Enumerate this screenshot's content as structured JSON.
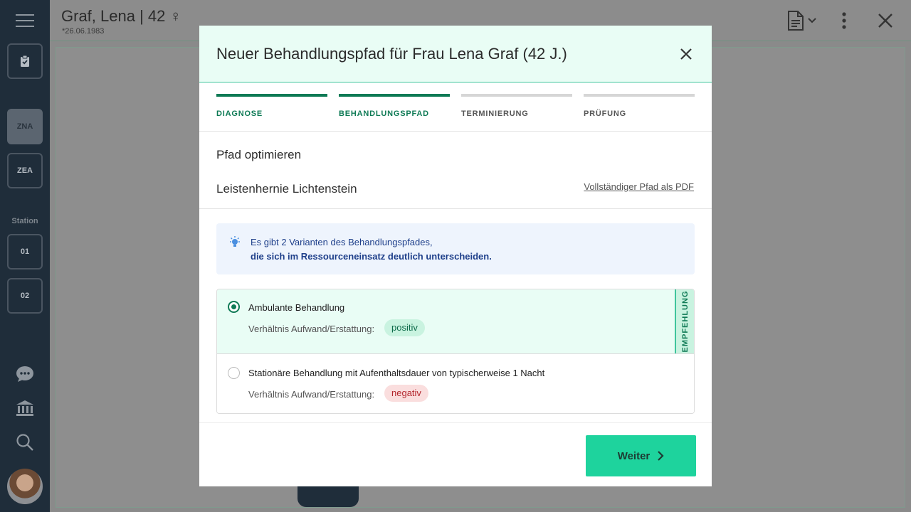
{
  "topbar": {
    "patient_name": "Graf, Lena | 42 ♀",
    "patient_dob": "*26.06.1983"
  },
  "sidebar": {
    "items": [
      {
        "label": "ZNA",
        "active": true
      },
      {
        "label": "ZEA",
        "active": false
      }
    ],
    "station_label": "Station",
    "stations": [
      {
        "label": "01"
      },
      {
        "label": "02"
      }
    ]
  },
  "modal": {
    "title": "Neuer Behandlungspfad für Frau Lena Graf (42 J.)",
    "steps": [
      {
        "label": "DIAGNOSE",
        "done": true
      },
      {
        "label": "BEHANDLUNGSPFAD",
        "done": true
      },
      {
        "label": "TERMINIERUNG",
        "done": false
      },
      {
        "label": "PRÜFUNG",
        "done": false
      }
    ],
    "section_title": "Pfad optimieren",
    "path_name": "Leistenhernie Lichtenstein",
    "pdf_link": "Vollständiger Pfad als PDF",
    "info": {
      "line1": "Es gibt 2 Varianten des Behandlungspfades,",
      "line2": "die sich im Ressourceneinsatz deutlich unterscheiden."
    },
    "options": [
      {
        "title": "Ambulante Behandlung",
        "meta_label": "Verhältnis Aufwand/Erstattung:",
        "badge": "positiv",
        "selected": true
      },
      {
        "title": "Stationäre Behandlung mit Aufenthaltsdauer von typischerweise 1 Nacht",
        "meta_label": "Verhältnis Aufwand/Erstattung:",
        "badge": "negativ",
        "selected": false
      }
    ],
    "recommendation": "EMPFEHLUNG",
    "next_label": "Weiter"
  },
  "colors": {
    "accent": "#1ed39d",
    "accent_dark": "#0e7a55",
    "sidebar_bg": "#1f2d3a",
    "info_text": "#1e3f8a"
  }
}
